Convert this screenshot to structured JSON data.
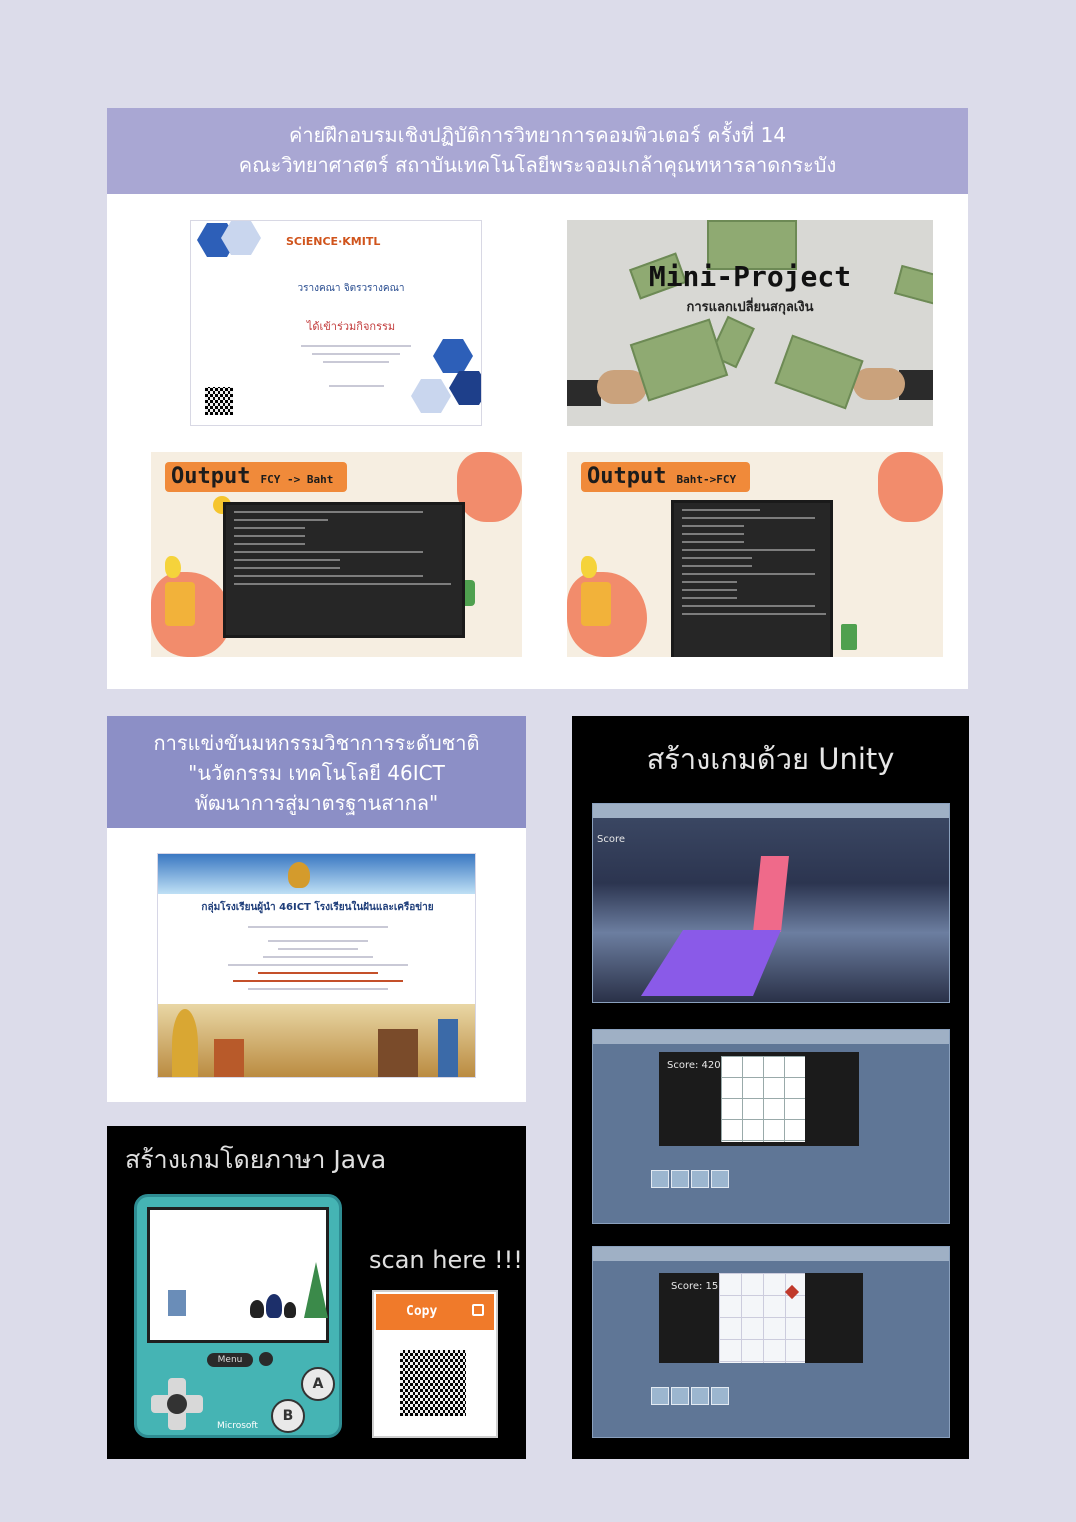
{
  "panel1": {
    "heading_line1": "ค่ายฝึกอบรมเชิงปฏิบัติการวิทยาการคอมพิวเตอร์ ครั้งที่ 14",
    "heading_line2": "คณะวิทยาศาสตร์ สถาบันเทคโนโลยีพระจอมเกล้าคุณทหารลาดกระบัง",
    "certificate": {
      "logo": "SCiENCE·KMITL",
      "name": "วรางคณา จิตรวรางคณา",
      "award": "ได้เข้าร่วมกิจกรรม"
    },
    "mini_project": {
      "title": "Mini-Project",
      "subtitle": "การแลกเปลี่ยนสกุลเงิน"
    },
    "output1": {
      "label": "Output",
      "direction": "FCY -> Baht"
    },
    "output2": {
      "label": "Output",
      "direction": "Baht->FCY"
    }
  },
  "panel2": {
    "heading_line1": "การแข่งขันมหกรรมวิชาการระดับชาติ",
    "heading_line2": "\"นวัตกรรม เทคโนโลยี 46ICT",
    "heading_line3": "พัฒนาการสู่มาตรฐานสากล\"",
    "certificate": {
      "org": "กลุ่มโรงเรียนผู้นำ 46ICT โรงเรียนในฝันและเครือข่าย"
    }
  },
  "panel3": {
    "title": "สร้างเกมโดยภาษา Java",
    "console": {
      "menu": "Menu",
      "button_a": "A",
      "button_b": "B",
      "brand": "Microsoft"
    },
    "scan_text": "scan here !!!",
    "copy_label": "Copy"
  },
  "panel4": {
    "title": "สร้างเกมด้วย Unity",
    "shots": [
      {
        "score": "Score"
      },
      {
        "score": "Score: 420"
      },
      {
        "score": "Score: 15"
      }
    ]
  },
  "colors": {
    "page": "#dcdcea",
    "panel1_header": "#a9a7d3",
    "panel2_header": "#8c8fc6",
    "accent_orange": "#f08a3a"
  }
}
